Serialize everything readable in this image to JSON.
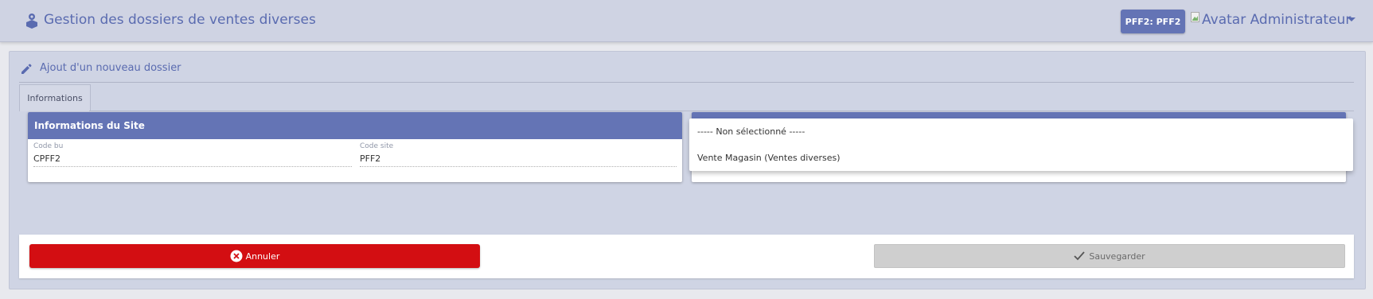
{
  "header": {
    "title": "Gestion des dossiers de ventes diverses",
    "site_badge": "PFF2: PFF2",
    "avatar_alt": "Avatar",
    "user_name": "Administrateur"
  },
  "panel": {
    "title": "Ajout d'un nouveau dossier",
    "tabs": [
      {
        "label": "Informations"
      }
    ]
  },
  "site_card": {
    "title": "Informations du Site",
    "fields": [
      {
        "label": "Code bu",
        "value": "CPFF2"
      },
      {
        "label": "Code site",
        "value": "PFF2"
      }
    ]
  },
  "dropdown": {
    "options": [
      "----- Non sélectionné -----",
      "Vente Magasin (Ventes diverses)"
    ]
  },
  "actions": {
    "cancel_label": "Annuler",
    "save_label": "Sauvegarder"
  },
  "colors": {
    "header_bg": "#cfd3e3",
    "accent": "#6474b5",
    "cancel": "#d30e12",
    "save_disabled": "#cfcfcf"
  }
}
